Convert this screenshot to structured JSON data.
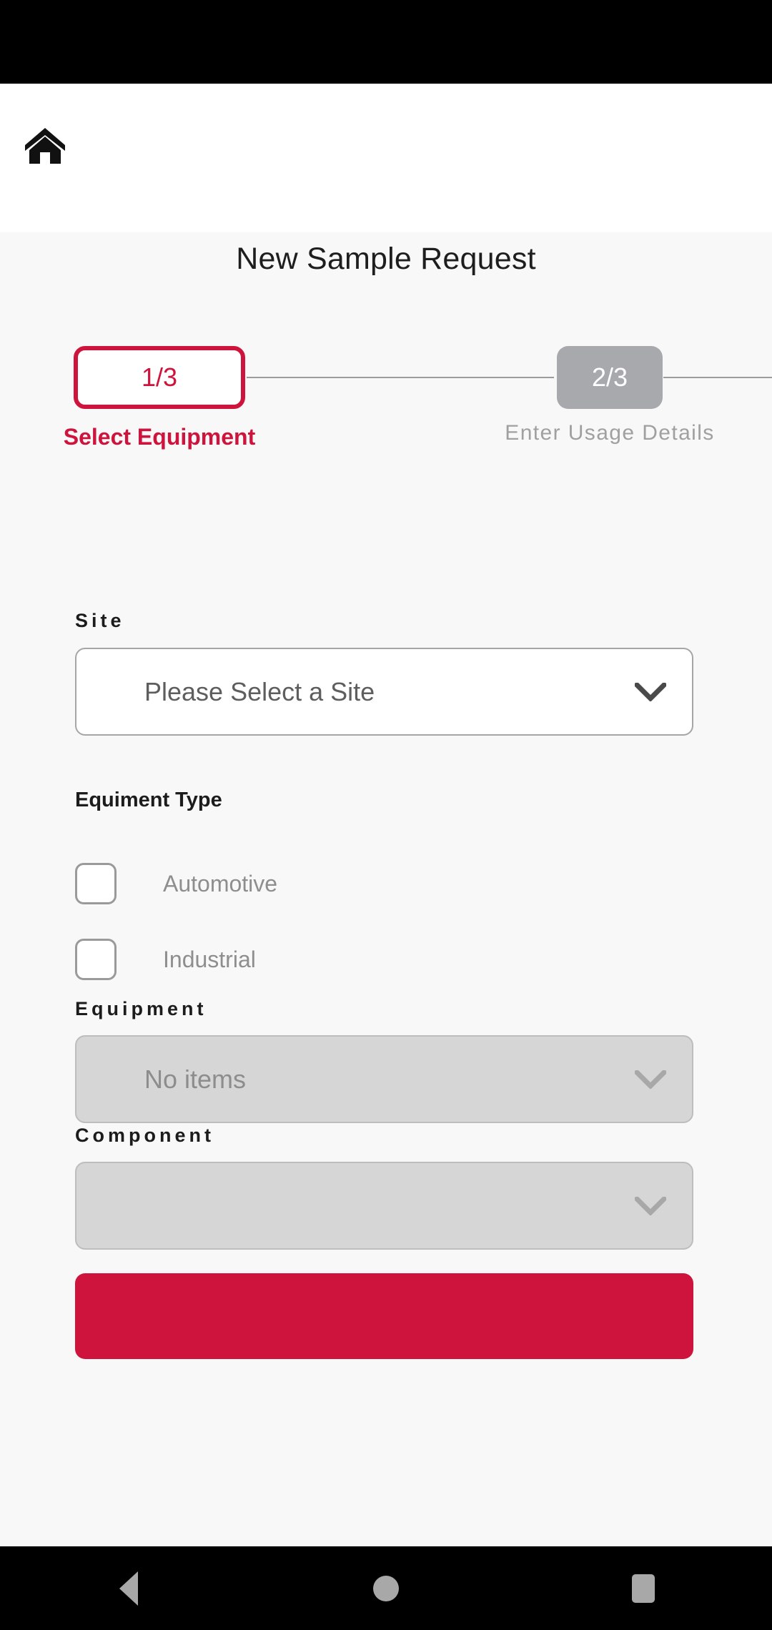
{
  "app_bar": {
    "home_icon": "home-icon"
  },
  "header": {
    "title": "New Sample Request"
  },
  "stepper": {
    "steps": [
      {
        "badge": "1/3",
        "label": "Select Equipment",
        "state": "active",
        "accent": "#CE143C"
      },
      {
        "badge": "2/3",
        "label": "Enter Usage Details",
        "state": "inactive",
        "accent": "#A7A9AC"
      }
    ]
  },
  "form": {
    "site": {
      "label": "Site",
      "value": "Please Select a Site",
      "enabled": true,
      "chevron": "chevron-down-icon"
    },
    "equipment_type": {
      "label": "Equiment Type",
      "options": [
        {
          "label": "Automotive",
          "checked": false
        },
        {
          "label": "Industrial",
          "checked": false
        }
      ]
    },
    "equipment": {
      "label": "Equipment",
      "value": "No items",
      "enabled": false,
      "chevron": "chevron-down-icon"
    },
    "component": {
      "label": "Component",
      "value": "",
      "enabled": false,
      "chevron": "chevron-down-icon"
    },
    "submit": {
      "label": ""
    }
  },
  "nav_bar": {
    "back": "back-triangle-icon",
    "home": "home-circle-icon",
    "recents": "recents-square-icon"
  },
  "colors": {
    "accent_red": "#CE143C",
    "inactive_gray": "#A7A9AC",
    "page_bg": "#F8F8F8",
    "app_bar_bg": "#FFFFFF",
    "system_bg": "#000000"
  }
}
